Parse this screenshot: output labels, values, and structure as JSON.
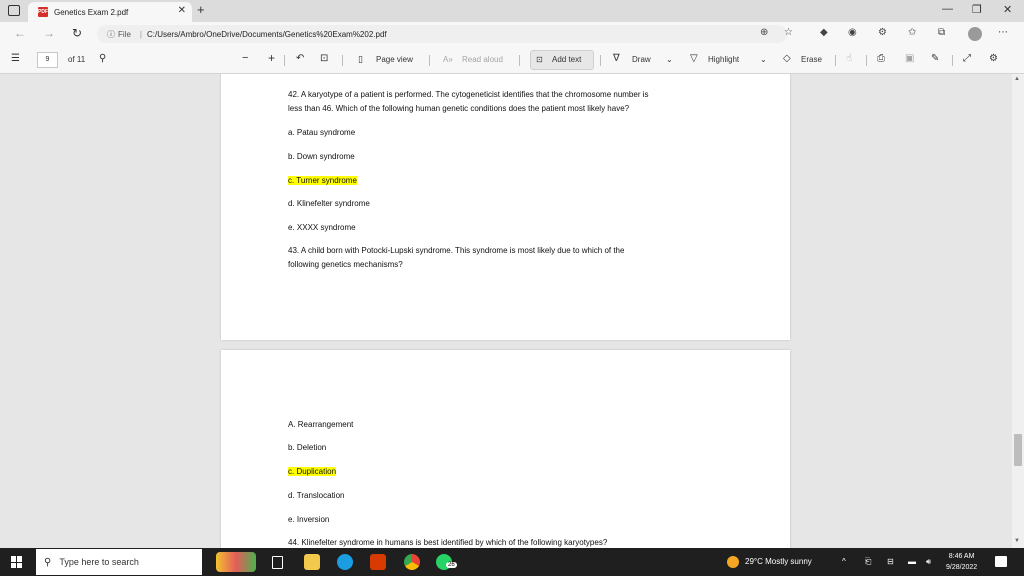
{
  "browser": {
    "tab_title": "Genetics Exam 2.pdf",
    "address_prefix": "File",
    "url": "C:/Users/Ambro/OneDrive/Documents/Genetics%20Exam%202.pdf"
  },
  "pdf_toolbar": {
    "page_number": "9",
    "page_total": "of 11",
    "page_view": "Page view",
    "read_aloud": "Read aloud",
    "add_text": "Add text",
    "draw": "Draw",
    "highlight": "Highlight",
    "erase": "Erase"
  },
  "document": {
    "q42": {
      "line1": "42.  A karyotype of a patient is performed. The cytogeneticist identifies that the chromosome number is",
      "line2": "less than 46. Which of the following human genetic conditions does the patient most likely have?",
      "options": [
        "a. Patau syndrome",
        "b. Down syndrome",
        "c. Turner syndrome",
        "d. Klinefelter syndrome",
        "e. XXXX syndrome"
      ]
    },
    "q43": {
      "line1": "43.  A child born with Potocki-Lupski syndrome. This syndrome is most likely due to which of the",
      "line2": "following genetics mechanisms?",
      "options": [
        "A. Rearrangement",
        "b. Deletion",
        "c. Duplication",
        "d. Translocation",
        "e. Inversion"
      ]
    },
    "q44": {
      "line1": "44.  Klinefelter syndrome in humans is best identified by which of the following karyotypes?"
    },
    "highlight_color": "#ffff00"
  },
  "taskbar": {
    "search_placeholder": "Type here to search",
    "whatsapp_badge": "26",
    "weather": "29°C  Mostly sunny",
    "time": "8:46 AM",
    "date": "9/28/2022"
  }
}
